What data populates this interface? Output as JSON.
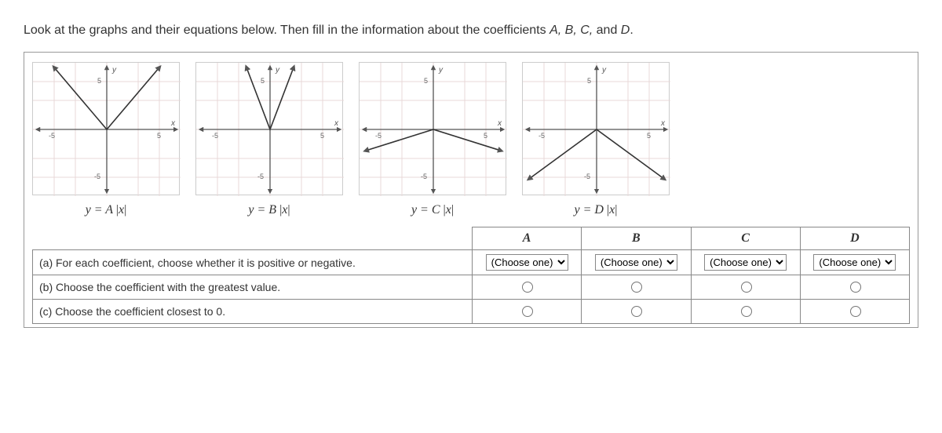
{
  "prompt_pre": "Look at the graphs and their equations below. Then fill in the information about the coefficients ",
  "prompt_vars": "A, B, C,",
  "prompt_and": " and ",
  "prompt_last": "D",
  "prompt_end": ".",
  "axis": {
    "x": "x",
    "y": "y",
    "pos5": "5",
    "neg5": "-5"
  },
  "eqns": {
    "a_pre": "y = A ",
    "a_x": "x",
    "b_pre": "y = B ",
    "b_x": "x",
    "c_pre": "y = C ",
    "c_x": "x",
    "d_pre": "y = D ",
    "d_x": "x"
  },
  "headers": {
    "A": "A",
    "B": "B",
    "C": "C",
    "D": "D"
  },
  "rows": {
    "a": "(a) For each coefficient, choose whether it is positive or negative.",
    "b": "(b) Choose the coefficient with the greatest value.",
    "c": "(c) Choose the coefficient closest to 0."
  },
  "dropdown_label": "(Choose one)",
  "chart_data": [
    {
      "type": "line",
      "title": "y = A|x|",
      "xlabel": "x",
      "ylabel": "y",
      "xlim": [
        -7,
        7
      ],
      "ylim": [
        -7,
        7
      ],
      "series": [
        {
          "name": "A",
          "x": [
            -5,
            0,
            5
          ],
          "y": [
            6.5,
            0,
            6.5
          ]
        }
      ]
    },
    {
      "type": "line",
      "title": "y = B|x|",
      "xlabel": "x",
      "ylabel": "y",
      "xlim": [
        -7,
        7
      ],
      "ylim": [
        -7,
        7
      ],
      "series": [
        {
          "name": "B",
          "x": [
            -2.2,
            0,
            2.2
          ],
          "y": [
            6.5,
            0,
            6.5
          ]
        }
      ]
    },
    {
      "type": "line",
      "title": "y = C|x|",
      "xlabel": "x",
      "ylabel": "y",
      "xlim": [
        -7,
        7
      ],
      "ylim": [
        -7,
        7
      ],
      "series": [
        {
          "name": "C",
          "x": [
            -6.5,
            0,
            6.5
          ],
          "y": [
            -2.2,
            0,
            -2.2
          ]
        }
      ]
    },
    {
      "type": "line",
      "title": "y = D|x|",
      "xlabel": "x",
      "ylabel": "y",
      "xlim": [
        -7,
        7
      ],
      "ylim": [
        -7,
        7
      ],
      "series": [
        {
          "name": "D",
          "x": [
            -6.5,
            0,
            6.5
          ],
          "y": [
            -5.2,
            0,
            -5.2
          ]
        }
      ]
    }
  ]
}
